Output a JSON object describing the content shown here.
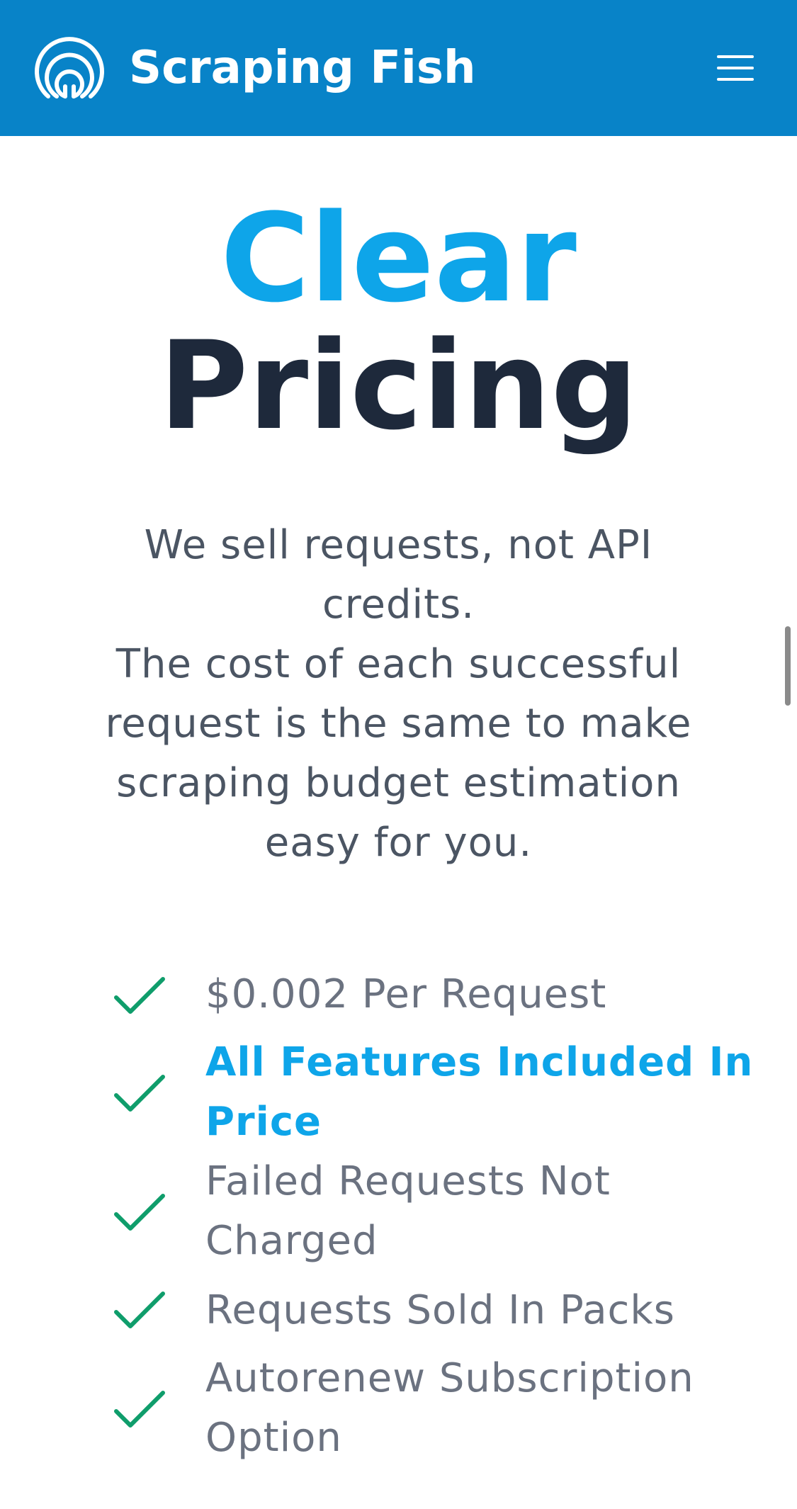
{
  "header": {
    "brand": "Scraping Fish",
    "logo_icon": "scraping-fish-logo-icon",
    "menu_icon": "hamburger-menu-icon",
    "background_color": "#0883c8"
  },
  "hero": {
    "title_accent": "Clear",
    "title_main": "Pricing",
    "accent_color": "#0ea5e9",
    "main_color": "#1e293b"
  },
  "description": {
    "line1": "We sell requests, not API credits.",
    "line2": "The cost of each successful request is the same to make scraping budget estimation easy for you."
  },
  "features": [
    {
      "label": "$0.002 Per Request",
      "highlight": false,
      "icon": "check-icon"
    },
    {
      "label": "All Features Included In Price",
      "highlight": true,
      "icon": "check-icon"
    },
    {
      "label": "Failed Requests Not Charged",
      "highlight": false,
      "icon": "check-icon"
    },
    {
      "label": "Requests Sold In Packs",
      "highlight": false,
      "icon": "check-icon"
    },
    {
      "label": "Autorenew Subscription Option",
      "highlight": false,
      "icon": "check-icon"
    }
  ],
  "check_color": "#0f9d6b"
}
